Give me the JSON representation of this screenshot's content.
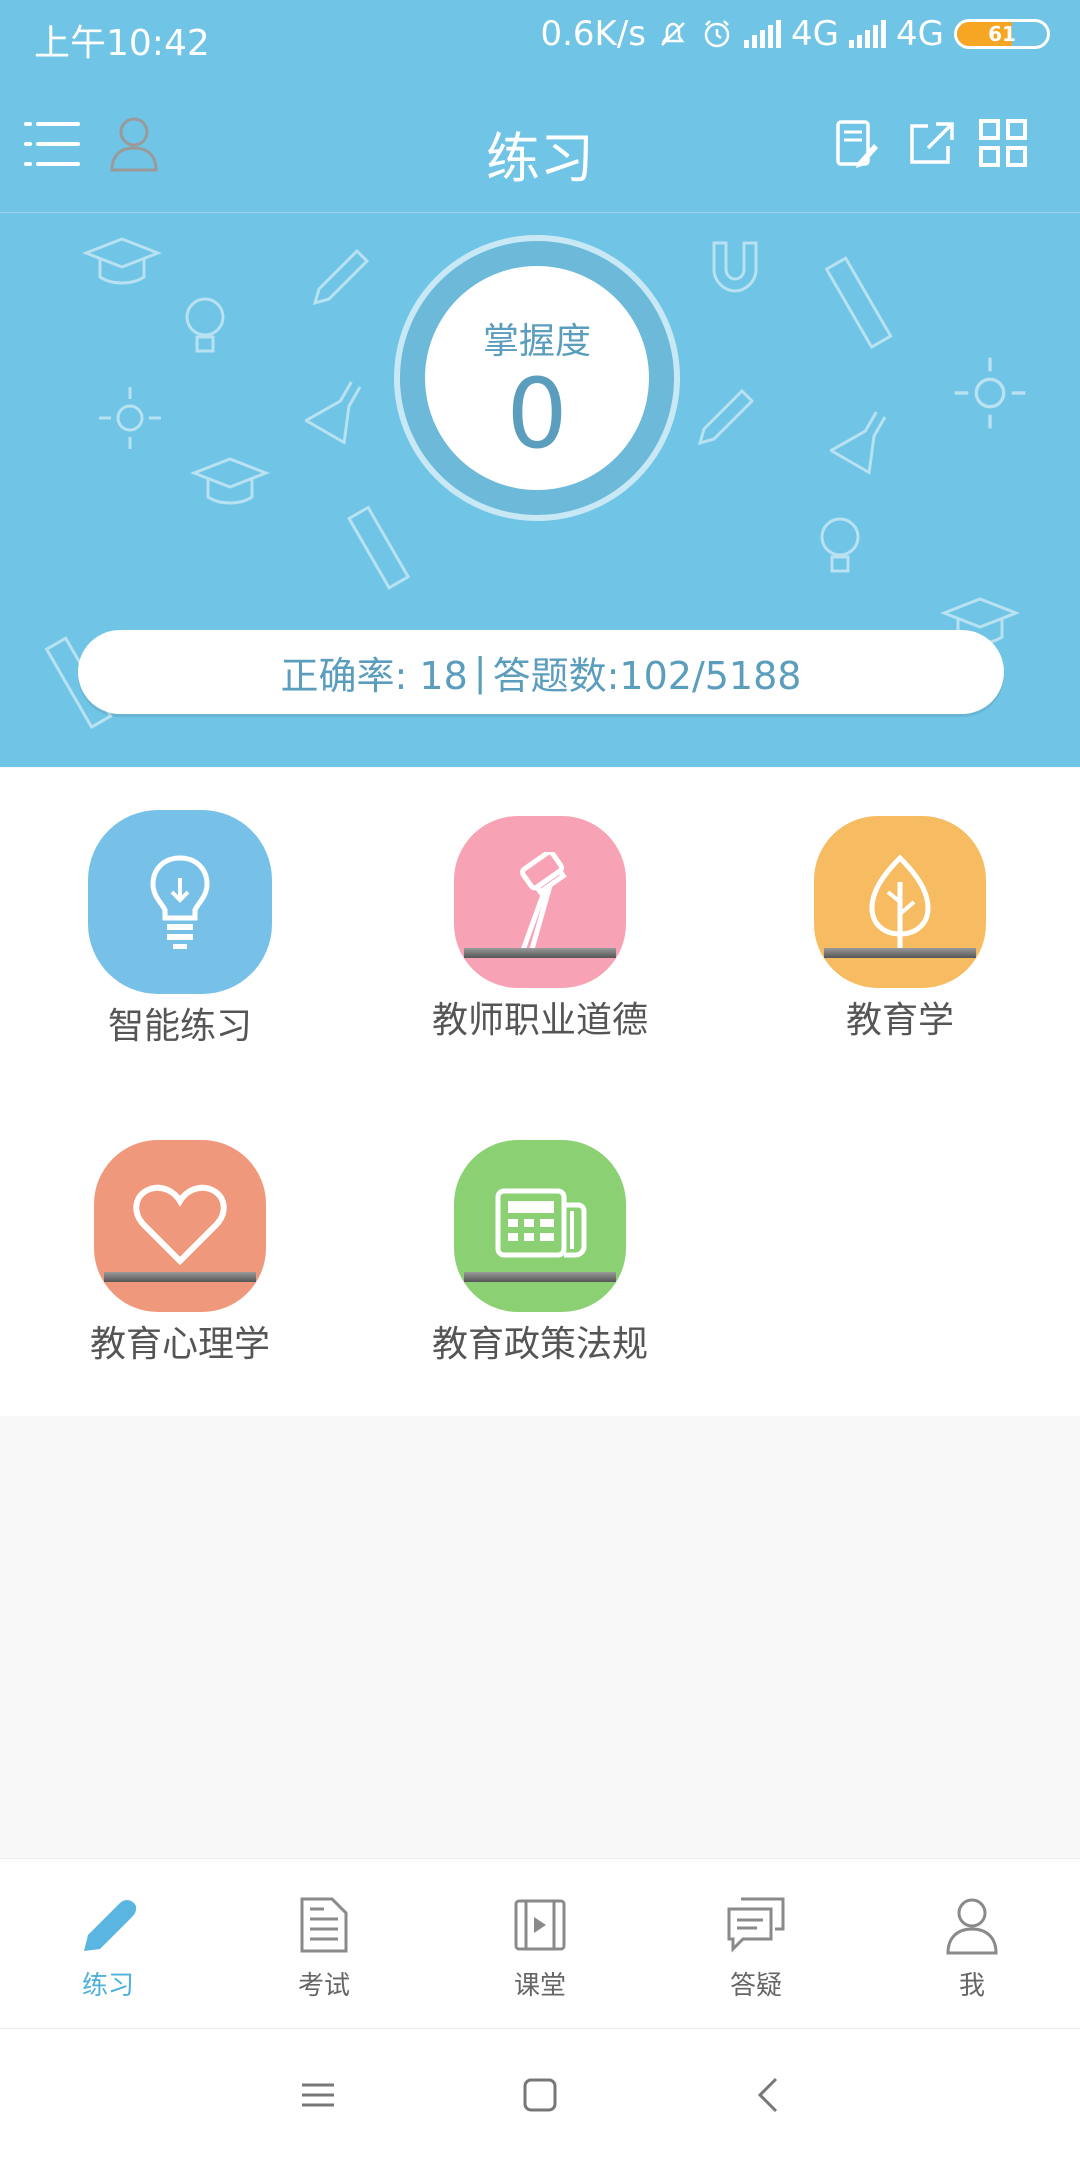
{
  "status_bar": {
    "time": "上午10:42",
    "net_speed": "0.6K/s",
    "network1": "4G",
    "network2": "4G",
    "battery": "61"
  },
  "header": {
    "title": "练习"
  },
  "hero": {
    "mastery_label": "掌握度",
    "mastery_value": "0",
    "accuracy_text": "正确率: 18",
    "separator": "|",
    "answered_text": "答题数:102/5188"
  },
  "categories": [
    {
      "label": "智能练习",
      "color": "#77c0e8",
      "icon": "lightbulb-icon"
    },
    {
      "label": "教师职业道德",
      "color": "#f7a3b5",
      "icon": "gavel-icon"
    },
    {
      "label": "教育学",
      "color": "#f7bc62",
      "icon": "leaf-icon"
    },
    {
      "label": "教育心理学",
      "color": "#f0987c",
      "icon": "heart-icon"
    },
    {
      "label": "教育政策法规",
      "color": "#8bd173",
      "icon": "newspaper-icon"
    }
  ],
  "bottom_nav": [
    {
      "label": "练习",
      "icon": "pencil-icon",
      "active": true
    },
    {
      "label": "考试",
      "icon": "exam-paper-icon",
      "active": false
    },
    {
      "label": "课堂",
      "icon": "video-film-icon",
      "active": false
    },
    {
      "label": "答疑",
      "icon": "chat-bubble-icon",
      "active": false
    },
    {
      "label": "我",
      "icon": "profile-icon",
      "active": false
    }
  ],
  "colors": {
    "brand": "#70c4e5",
    "accent_text": "#5b9dbd",
    "active_tab": "#4db0dd"
  }
}
